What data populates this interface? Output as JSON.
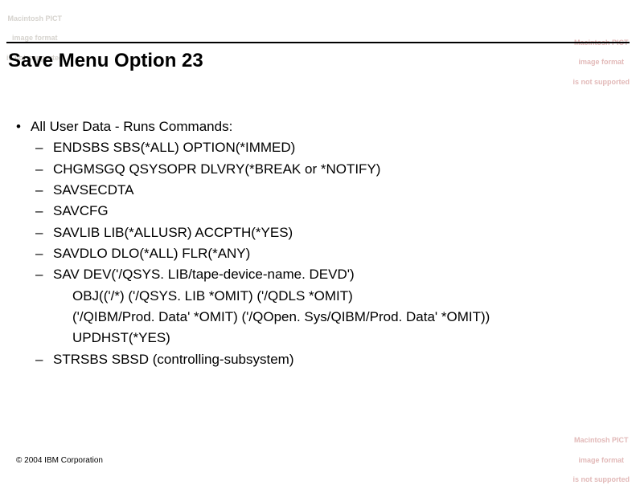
{
  "placeholder": {
    "line1": "Macintosh PICT",
    "line2": "image format",
    "line3": "is not supported"
  },
  "title": "Save Menu Option 23",
  "bullet": {
    "text": "All User Data - Runs Commands:"
  },
  "subs": {
    "s1": "ENDSBS SBS(*ALL) OPTION(*IMMED)",
    "s2": "CHGMSGQ QSYSOPR DLVRY(*BREAK or *NOTIFY)",
    "s3": "SAVSECDTA",
    "s4": "SAVCFG",
    "s5": "SAVLIB LIB(*ALLUSR) ACCPTH(*YES)",
    "s6": "SAVDLO DLO(*ALL) FLR(*ANY)",
    "s7": "SAV DEV('/QSYS. LIB/tape-device-name. DEVD')",
    "s7b": "OBJ(('/*) ('/QSYS. LIB *OMIT) ('/QDLS *OMIT)",
    "s7c": "('/QIBM/Prod. Data' *OMIT) ('/QOpen. Sys/QIBM/Prod. Data' *OMIT))",
    "s7d": "UPDHST(*YES)",
    "s8": "STRSBS SBSD (controlling-subsystem)"
  },
  "symbols": {
    "bullet": "•",
    "dash": "–"
  },
  "copyright": "© 2004 IBM Corporation"
}
